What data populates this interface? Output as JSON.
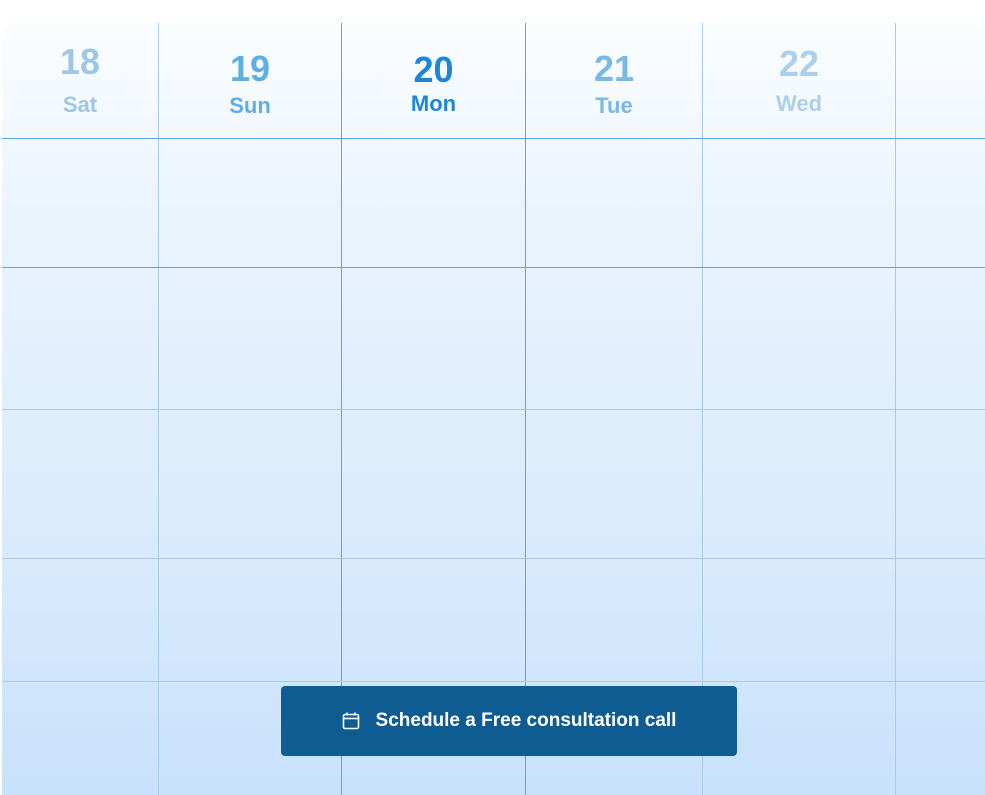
{
  "days": [
    {
      "number": "18",
      "name": "Sat"
    },
    {
      "number": "19",
      "name": "Sun"
    },
    {
      "number": "20",
      "name": "Mon"
    },
    {
      "number": "21",
      "name": "Tue"
    },
    {
      "number": "22",
      "name": "Wed"
    }
  ],
  "selected_day": "20",
  "cta": {
    "label": "Schedule a Free consultation call",
    "icon": "calendar-icon"
  },
  "colors": {
    "accent": "#1d86d6",
    "button": "#0f5c92"
  }
}
